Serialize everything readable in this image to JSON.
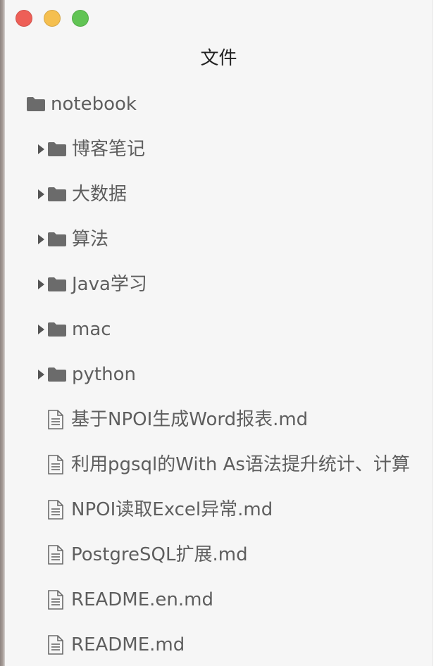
{
  "window": {
    "title": "文件",
    "controls": [
      "close",
      "minimize",
      "maximize"
    ]
  },
  "tree": {
    "root": {
      "label": "notebook",
      "icon": "folder-icon"
    },
    "folders": [
      {
        "label": "博客笔记",
        "icon": "folder-icon",
        "expand_icon": "disclosure-arrow-icon"
      },
      {
        "label": "大数据",
        "icon": "folder-icon",
        "expand_icon": "disclosure-arrow-icon"
      },
      {
        "label": "算法",
        "icon": "folder-icon",
        "expand_icon": "disclosure-arrow-icon"
      },
      {
        "label": "Java学习",
        "icon": "folder-icon",
        "expand_icon": "disclosure-arrow-icon"
      },
      {
        "label": "mac",
        "icon": "folder-icon",
        "expand_icon": "disclosure-arrow-icon"
      },
      {
        "label": "python",
        "icon": "folder-icon",
        "expand_icon": "disclosure-arrow-icon"
      }
    ],
    "files": [
      {
        "label": "基于NPOI生成Word报表.md",
        "icon": "document-icon"
      },
      {
        "label": "利用pgsql的With As语法提升统计、计算",
        "icon": "document-icon"
      },
      {
        "label": "NPOI读取Excel异常.md",
        "icon": "document-icon"
      },
      {
        "label": "PostgreSQL扩展.md",
        "icon": "document-icon"
      },
      {
        "label": "README.en.md",
        "icon": "document-icon"
      },
      {
        "label": "README.md",
        "icon": "document-icon"
      }
    ]
  },
  "colors": {
    "background": "#f6f6f6",
    "text": "#5e5e5e",
    "icon": "#6b6b6b",
    "close": "#ee5f57",
    "minimize": "#f5bf4f",
    "maximize": "#61c454"
  }
}
